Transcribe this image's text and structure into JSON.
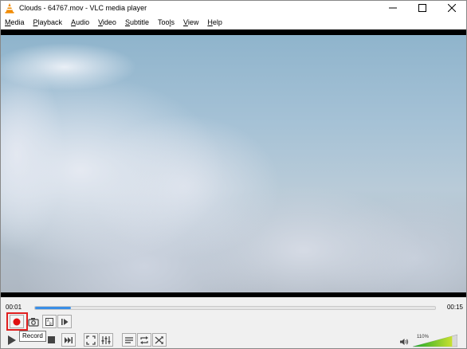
{
  "window": {
    "title": "Clouds - 64767.mov - VLC media player",
    "controls": {
      "minimize": "—",
      "maximize": "☐",
      "close": "✕"
    }
  },
  "menu": [
    {
      "label": "Media",
      "underline": "M",
      "rest": "edia"
    },
    {
      "label": "Playback",
      "underline": "P",
      "rest": "layback"
    },
    {
      "label": "Audio",
      "underline": "A",
      "rest": "udio"
    },
    {
      "label": "Video",
      "underline": "V",
      "rest": "ideo"
    },
    {
      "label": "Subtitle",
      "underline": "S",
      "rest": "ubtitle"
    },
    {
      "label": "Tools",
      "pre": "Too",
      "underline": "l",
      "rest": "s"
    },
    {
      "label": "View",
      "underline": "V",
      "rest": "iew"
    },
    {
      "label": "Help",
      "underline": "H",
      "rest": "elp"
    }
  ],
  "playback": {
    "current_time": "00:01",
    "total_time": "00:15",
    "progress": 0.09
  },
  "tooltip": {
    "text": "Record"
  },
  "volume": {
    "label": "110%",
    "level": 1.1
  },
  "colors": {
    "record_highlight": "#e02020",
    "record_dot": "#e01010",
    "seek_fill": "#3a8ee6",
    "volume_low": "#1aa82a",
    "volume_high": "#c8e030"
  },
  "icons": {
    "record": "record-icon",
    "snapshot": "camera-icon",
    "ab_loop": "ab-loop-icon",
    "frame": "frame-by-frame-icon",
    "play": "play-icon",
    "stop": "stop-icon",
    "next": "next-icon",
    "fullscreen": "fullscreen-icon",
    "equalizer": "equalizer-icon",
    "playlist": "playlist-icon",
    "loop": "loop-icon",
    "shuffle": "shuffle-icon",
    "volume": "speaker-icon"
  }
}
